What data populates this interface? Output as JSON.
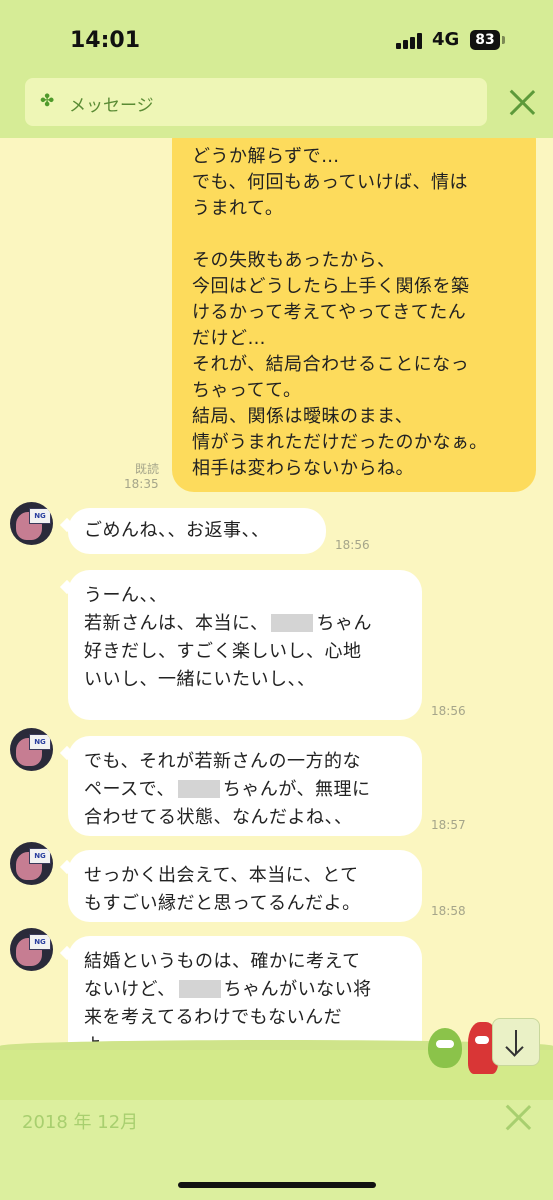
{
  "status": {
    "time": "14:01",
    "network": "4G",
    "battery": "83"
  },
  "header": {
    "search_label": "メッセージ",
    "clover_icon": "clover-icon",
    "close_icon": "close-icon"
  },
  "outgoing": {
    "lines": [
      "どうか解らずで…",
      "でも、何回もあっていけば、情は",
      "うまれて。",
      "",
      "その失敗もあったから、",
      "今回はどうしたら上手く関係を築",
      "けるかって考えてやってきてたん",
      "だけど…",
      "それが、結局合わせることになっ",
      "ちゃってて。",
      "結局、関係は曖昧のまま、",
      "情がうまれただけだったのかなぁ。",
      "相手は変わらないからね。"
    ],
    "read": "既読",
    "time": "18:35"
  },
  "messages": [
    {
      "lines": [
        "ごめんね、、お返事、、"
      ],
      "time": "18:56"
    },
    {
      "lines": [
        "うーん、、",
        "若新さんは、本当に、",
        "好きだし、すごく楽しいし、心地",
        "いいし、一緒にいたいし、、",
        ""
      ],
      "blur_suffix": "ちゃん",
      "time": "18:56"
    },
    {
      "lines": [
        "でも、それが若新さんの一方的な",
        "ペースで、",
        "合わせてる状態、なんだよね、、"
      ],
      "blur_suffix": "ちゃんが、無理に",
      "time": "18:57"
    },
    {
      "lines": [
        "せっかく出会えて、本当に、とて",
        "もすごい縁だと思ってるんだよ。"
      ],
      "time": "18:58"
    },
    {
      "lines": [
        "結婚というものは、確かに考えて",
        "ないけど、",
        "来を考えてるわけでもないんだ",
        "よ、、"
      ],
      "blur_suffix": "ちゃんがいない将"
    }
  ],
  "avatar": {
    "badge": "NG"
  },
  "footer": {
    "date": "2018 年 12月"
  },
  "colors": {
    "bg": "#fbf6c0",
    "header": "#d6ec96",
    "outgoing": "#fddb5c",
    "incoming": "#ffffff",
    "time": "#a5a58a"
  }
}
